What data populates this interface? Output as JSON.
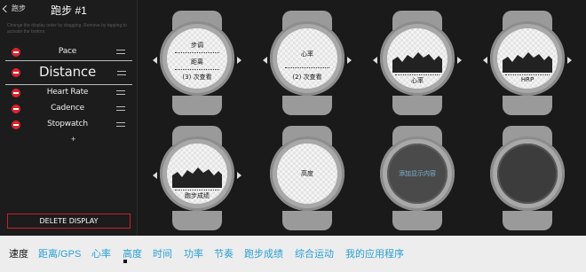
{
  "header": {
    "back_label": "跑步",
    "title": "跑步 #1"
  },
  "hint": "Change the display order by dragging. Remove by tapping to activate the bottom.",
  "fields": [
    {
      "label": "Pace",
      "size": "normal"
    },
    {
      "label": "Distance",
      "size": "large"
    },
    {
      "label": "Heart Rate",
      "size": "normal"
    },
    {
      "label": "Cadence",
      "size": "normal"
    },
    {
      "label": "Stopwatch",
      "size": "normal"
    }
  ],
  "add_symbol": "+",
  "delete_label": "DELETE DISPLAY",
  "watches": [
    {
      "kind": "three",
      "lines": [
        "步调",
        "距离",
        "(3) 次查看"
      ]
    },
    {
      "kind": "two",
      "lines": [
        "心率",
        "(2) 次查看"
      ]
    },
    {
      "kind": "graph",
      "label": "心率"
    },
    {
      "kind": "graph",
      "label": "HRP"
    },
    {
      "kind": "graph",
      "label": "跑步成绩"
    },
    {
      "kind": "single",
      "label": "高度"
    },
    {
      "kind": "add",
      "label": "添加显示内容"
    },
    {
      "kind": "empty"
    }
  ],
  "tabs": [
    "速度",
    "距离/GPS",
    "心率",
    "高度",
    "时间",
    "功率",
    "节奏",
    "跑步成绩",
    "综合运动",
    "我的应用程序"
  ],
  "active_tab": "速度",
  "colors": {
    "accent": "#2aa0d6",
    "danger": "#d8262e",
    "panel_bg": "#1c1c1c",
    "tab_bar_bg": "#ededed"
  }
}
